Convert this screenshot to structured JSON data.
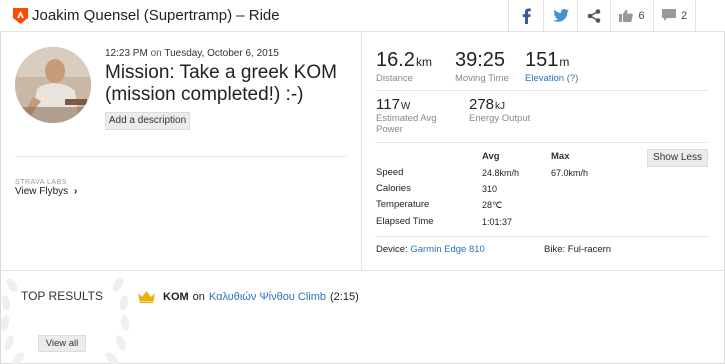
{
  "header": {
    "title": "Joakim Quensel (Supertramp) – Ride",
    "kudos_count": "6",
    "comment_count": "2",
    "icons": [
      "ride-sport-icon",
      "facebook-icon",
      "twitter-icon",
      "share-icon",
      "thumbs-up-icon",
      "comment-icon"
    ]
  },
  "activity": {
    "time": "12:23 PM",
    "on_label": "on",
    "date": "Tuesday, October 6, 2015",
    "name": "Mission: Take a greek KOM (mission completed!) :-)",
    "add_description": "Add a description",
    "labs_label": "STRAVA LABS",
    "flyby_label": "View Flybys"
  },
  "stats": {
    "distance": {
      "value": "16.2",
      "unit": "km",
      "label": "Distance"
    },
    "moving_time": {
      "value": "39:25",
      "label": "Moving Time"
    },
    "elevation": {
      "value": "151",
      "unit": "m",
      "label": "Elevation (?)"
    },
    "power": {
      "value": "117",
      "unit": "W",
      "label": "Estimated Avg Power"
    },
    "energy": {
      "value": "278",
      "unit": "kJ",
      "label": "Energy Output"
    }
  },
  "details": {
    "col_avg": "Avg",
    "col_max": "Max",
    "show_less": "Show Less",
    "rows": [
      {
        "label": "Speed",
        "avg": "24.8km/h",
        "max": "67.0km/h"
      },
      {
        "label": "Calories",
        "avg": "310",
        "max": ""
      },
      {
        "label": "Temperature",
        "avg": "28℃",
        "max": ""
      },
      {
        "label": "Elapsed Time",
        "avg": "1:01:37",
        "max": ""
      }
    ],
    "device_label": "Device:",
    "device_value": "Garmin Edge 810",
    "bike_label": "Bike:",
    "bike_value": "Ful-racern"
  },
  "results": {
    "heading": "TOP RESULTS",
    "view_all": "View all",
    "achievement_type": "KOM",
    "achievement_on": "on",
    "segment_name": "Καλυθιών Ψίνθου Climb",
    "segment_time": "(2:15)"
  },
  "colors": {
    "accent": "#fc4c02",
    "link": "#2a72b8",
    "crown": "#e8b20e"
  }
}
